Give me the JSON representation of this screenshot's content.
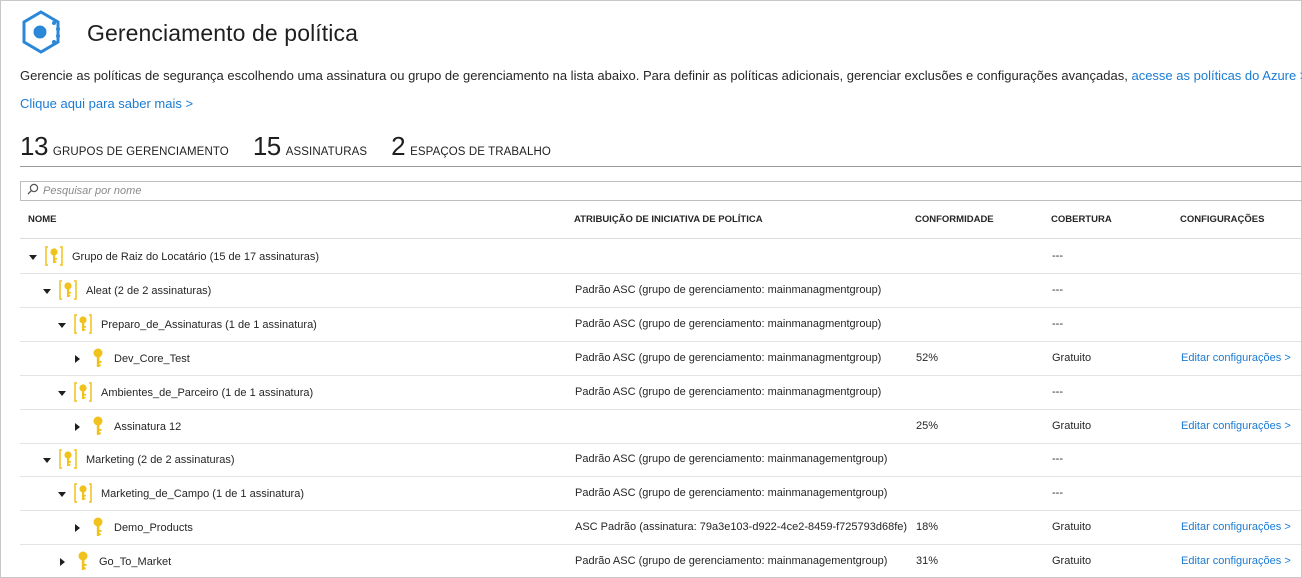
{
  "title": "Gerenciamento de política",
  "description": {
    "text": "Gerencie as políticas de segurança escolhendo uma assinatura ou grupo de gerenciamento na lista abaixo. Para definir as políticas adicionais, gerenciar exclusões e configurações avançadas,",
    "link": "acesse as políticas do Azure >"
  },
  "learn_more": "Clique aqui para saber mais >",
  "stats": [
    {
      "count": "13",
      "label": "Grupos de gerenciamento"
    },
    {
      "count": "15",
      "label": "Assinaturas"
    },
    {
      "count": "2",
      "label": "Espaços de trabalho"
    }
  ],
  "search": {
    "placeholder": "Pesquisar por nome"
  },
  "columns": {
    "name": "Nome",
    "assignment": "Atribuição de iniciativa de política",
    "compliance": "Conformidade",
    "coverage": "Cobertura",
    "settings": "Configurações"
  },
  "rows": [
    {
      "name": "Grupo de Raiz do Locatário (15 de 17 assinaturas)",
      "assignment": "",
      "compliance": "",
      "coverage": "---",
      "settings": ""
    },
    {
      "name": "Aleat (2 de 2 assinaturas)",
      "assignment": "Padrão ASC (grupo de gerenciamento: mainmanagmentgroup)",
      "compliance": "",
      "coverage": "---",
      "settings": ""
    },
    {
      "name": "Preparo_de_Assinaturas (1 de 1 assinatura)",
      "assignment": "Padrão ASC (grupo de gerenciamento: mainmanagmentgroup)",
      "compliance": "",
      "coverage": "---",
      "settings": ""
    },
    {
      "name": "Dev_Core_Test",
      "assignment": "Padrão ASC (grupo de gerenciamento: mainmanagmentgroup)",
      "compliance": "52%",
      "coverage": "Gratuito",
      "settings": "Editar configurações >"
    },
    {
      "name": "Ambientes_de_Parceiro (1 de 1 assinatura)",
      "assignment": "Padrão ASC (grupo de gerenciamento: mainmanagmentgroup)",
      "compliance": "",
      "coverage": "---",
      "settings": ""
    },
    {
      "name": "Assinatura 12",
      "assignment": "",
      "compliance": "25%",
      "coverage": "Gratuito",
      "settings": "Editar configurações >"
    },
    {
      "name": "Marketing (2 de 2 assinaturas)",
      "assignment": "Padrão ASC (grupo de gerenciamento: mainmanagementgroup)",
      "compliance": "",
      "coverage": "---",
      "settings": ""
    },
    {
      "name": "Marketing_de_Campo (1 de 1 assinatura)",
      "assignment": "Padrão ASC (grupo de gerenciamento: mainmanagementgroup)",
      "compliance": "",
      "coverage": "---",
      "settings": ""
    },
    {
      "name": "Demo_Products",
      "assignment": "ASC Padrão (assinatura: 79a3e103-d922-4ce2-8459-f725793d68fe)",
      "compliance": "18%",
      "coverage": "Gratuito",
      "settings": "Editar configurações >"
    },
    {
      "name": "Go_To_Market",
      "assignment": "Padrão ASC (grupo de gerenciamento: mainmanagementgroup)",
      "compliance": "31%",
      "coverage": "Gratuito",
      "settings": "Editar configurações >"
    }
  ],
  "icons": {
    "app": "security-center-icon",
    "group": "management-group-key-icon",
    "subscription": "subscription-key-icon",
    "expanded": "caret-down-icon",
    "collapsed": "caret-right-icon",
    "search": "search-icon"
  },
  "colors": {
    "link": "#1a7bd2",
    "key": "#f0c21b",
    "app_icon": "#2b88d8"
  }
}
